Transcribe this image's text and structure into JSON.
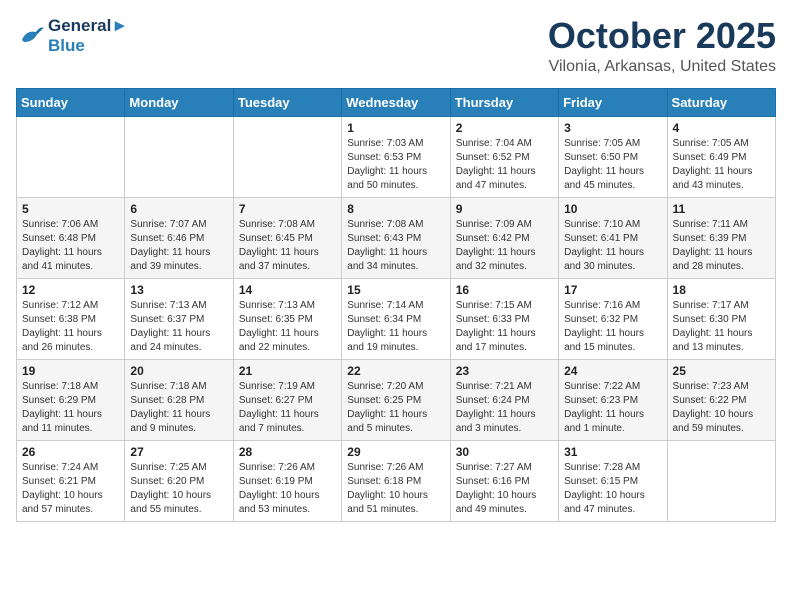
{
  "logo": {
    "line1": "General",
    "line2": "Blue"
  },
  "title": "October 2025",
  "location": "Vilonia, Arkansas, United States",
  "days_of_week": [
    "Sunday",
    "Monday",
    "Tuesday",
    "Wednesday",
    "Thursday",
    "Friday",
    "Saturday"
  ],
  "weeks": [
    [
      {
        "num": "",
        "info": ""
      },
      {
        "num": "",
        "info": ""
      },
      {
        "num": "",
        "info": ""
      },
      {
        "num": "1",
        "info": "Sunrise: 7:03 AM\nSunset: 6:53 PM\nDaylight: 11 hours\nand 50 minutes."
      },
      {
        "num": "2",
        "info": "Sunrise: 7:04 AM\nSunset: 6:52 PM\nDaylight: 11 hours\nand 47 minutes."
      },
      {
        "num": "3",
        "info": "Sunrise: 7:05 AM\nSunset: 6:50 PM\nDaylight: 11 hours\nand 45 minutes."
      },
      {
        "num": "4",
        "info": "Sunrise: 7:05 AM\nSunset: 6:49 PM\nDaylight: 11 hours\nand 43 minutes."
      }
    ],
    [
      {
        "num": "5",
        "info": "Sunrise: 7:06 AM\nSunset: 6:48 PM\nDaylight: 11 hours\nand 41 minutes."
      },
      {
        "num": "6",
        "info": "Sunrise: 7:07 AM\nSunset: 6:46 PM\nDaylight: 11 hours\nand 39 minutes."
      },
      {
        "num": "7",
        "info": "Sunrise: 7:08 AM\nSunset: 6:45 PM\nDaylight: 11 hours\nand 37 minutes."
      },
      {
        "num": "8",
        "info": "Sunrise: 7:08 AM\nSunset: 6:43 PM\nDaylight: 11 hours\nand 34 minutes."
      },
      {
        "num": "9",
        "info": "Sunrise: 7:09 AM\nSunset: 6:42 PM\nDaylight: 11 hours\nand 32 minutes."
      },
      {
        "num": "10",
        "info": "Sunrise: 7:10 AM\nSunset: 6:41 PM\nDaylight: 11 hours\nand 30 minutes."
      },
      {
        "num": "11",
        "info": "Sunrise: 7:11 AM\nSunset: 6:39 PM\nDaylight: 11 hours\nand 28 minutes."
      }
    ],
    [
      {
        "num": "12",
        "info": "Sunrise: 7:12 AM\nSunset: 6:38 PM\nDaylight: 11 hours\nand 26 minutes."
      },
      {
        "num": "13",
        "info": "Sunrise: 7:13 AM\nSunset: 6:37 PM\nDaylight: 11 hours\nand 24 minutes."
      },
      {
        "num": "14",
        "info": "Sunrise: 7:13 AM\nSunset: 6:35 PM\nDaylight: 11 hours\nand 22 minutes."
      },
      {
        "num": "15",
        "info": "Sunrise: 7:14 AM\nSunset: 6:34 PM\nDaylight: 11 hours\nand 19 minutes."
      },
      {
        "num": "16",
        "info": "Sunrise: 7:15 AM\nSunset: 6:33 PM\nDaylight: 11 hours\nand 17 minutes."
      },
      {
        "num": "17",
        "info": "Sunrise: 7:16 AM\nSunset: 6:32 PM\nDaylight: 11 hours\nand 15 minutes."
      },
      {
        "num": "18",
        "info": "Sunrise: 7:17 AM\nSunset: 6:30 PM\nDaylight: 11 hours\nand 13 minutes."
      }
    ],
    [
      {
        "num": "19",
        "info": "Sunrise: 7:18 AM\nSunset: 6:29 PM\nDaylight: 11 hours\nand 11 minutes."
      },
      {
        "num": "20",
        "info": "Sunrise: 7:18 AM\nSunset: 6:28 PM\nDaylight: 11 hours\nand 9 minutes."
      },
      {
        "num": "21",
        "info": "Sunrise: 7:19 AM\nSunset: 6:27 PM\nDaylight: 11 hours\nand 7 minutes."
      },
      {
        "num": "22",
        "info": "Sunrise: 7:20 AM\nSunset: 6:25 PM\nDaylight: 11 hours\nand 5 minutes."
      },
      {
        "num": "23",
        "info": "Sunrise: 7:21 AM\nSunset: 6:24 PM\nDaylight: 11 hours\nand 3 minutes."
      },
      {
        "num": "24",
        "info": "Sunrise: 7:22 AM\nSunset: 6:23 PM\nDaylight: 11 hours\nand 1 minute."
      },
      {
        "num": "25",
        "info": "Sunrise: 7:23 AM\nSunset: 6:22 PM\nDaylight: 10 hours\nand 59 minutes."
      }
    ],
    [
      {
        "num": "26",
        "info": "Sunrise: 7:24 AM\nSunset: 6:21 PM\nDaylight: 10 hours\nand 57 minutes."
      },
      {
        "num": "27",
        "info": "Sunrise: 7:25 AM\nSunset: 6:20 PM\nDaylight: 10 hours\nand 55 minutes."
      },
      {
        "num": "28",
        "info": "Sunrise: 7:26 AM\nSunset: 6:19 PM\nDaylight: 10 hours\nand 53 minutes."
      },
      {
        "num": "29",
        "info": "Sunrise: 7:26 AM\nSunset: 6:18 PM\nDaylight: 10 hours\nand 51 minutes."
      },
      {
        "num": "30",
        "info": "Sunrise: 7:27 AM\nSunset: 6:16 PM\nDaylight: 10 hours\nand 49 minutes."
      },
      {
        "num": "31",
        "info": "Sunrise: 7:28 AM\nSunset: 6:15 PM\nDaylight: 10 hours\nand 47 minutes."
      },
      {
        "num": "",
        "info": ""
      }
    ]
  ]
}
